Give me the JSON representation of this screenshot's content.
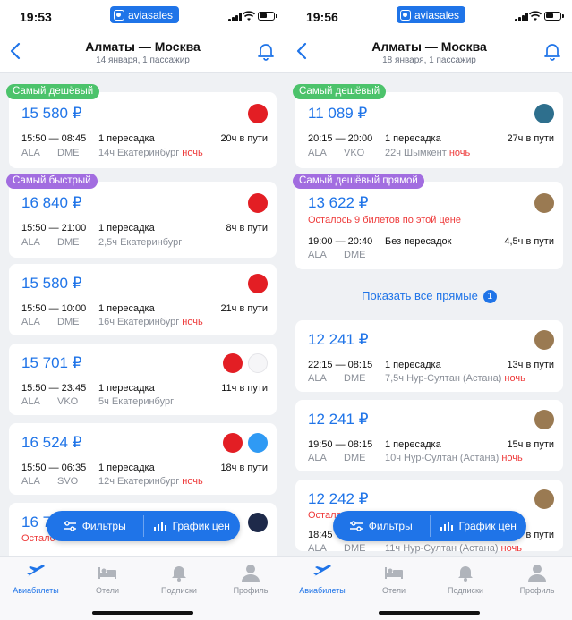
{
  "app_badge": "aviasales",
  "tabs": [
    {
      "label": "Авиабилеты",
      "icon": "plane-icon",
      "active": true
    },
    {
      "label": "Отели",
      "icon": "bed-icon",
      "active": false
    },
    {
      "label": "Подписки",
      "icon": "bell-icon",
      "active": false
    },
    {
      "label": "Профиль",
      "icon": "person-icon",
      "active": false
    }
  ],
  "floatbar": {
    "filters": "Фильтры",
    "chart": "График цен"
  },
  "colors": {
    "accent": "#1f74e8",
    "cheapest_tag": "#4cc36b",
    "fastest_tag": "#a26de0",
    "night": "#ee3a3a",
    "background": "#eff1f4"
  },
  "left": {
    "time": "19:53",
    "title": "Алматы — Москва",
    "subtitle": "14 января, 1 пассажир",
    "tickets": [
      {
        "tag": "Самый дешёвый",
        "price": "15 580 ₽",
        "dep": "15:50",
        "arr": "08:45",
        "stops": "1 пересадка",
        "duration": "20ч в пути",
        "from": "ALA",
        "to": "DME",
        "via": "14ч Екатеринбург",
        "night": "ночь"
      },
      {
        "tag": "Самый быстрый",
        "price": "16 840 ₽",
        "dep": "15:50",
        "arr": "21:00",
        "stops": "1 пересадка",
        "duration": "8ч в пути",
        "from": "ALA",
        "to": "DME",
        "via": "2,5ч Екатеринбург",
        "night": ""
      },
      {
        "tag": "",
        "price": "15 580 ₽",
        "dep": "15:50",
        "arr": "10:00",
        "stops": "1 пересадка",
        "duration": "21ч в пути",
        "from": "ALA",
        "to": "DME",
        "via": "16ч Екатеринбург",
        "night": "ночь"
      },
      {
        "tag": "",
        "price": "15 701 ₽",
        "dep": "15:50",
        "arr": "23:45",
        "stops": "1 пересадка",
        "duration": "11ч в пути",
        "from": "ALA",
        "to": "VKO",
        "via": "5ч Екатеринбург",
        "night": ""
      },
      {
        "tag": "",
        "price": "16 524 ₽",
        "dep": "15:50",
        "arr": "06:35",
        "stops": "1 пересадка",
        "duration": "18ч в пути",
        "from": "ALA",
        "to": "SVO",
        "via": "12ч Екатеринбург",
        "night": "ночь"
      },
      {
        "tag": "",
        "price": "16 7",
        "warn": "Остало"
      }
    ]
  },
  "right": {
    "time": "19:56",
    "title": "Алматы — Москва",
    "subtitle": "18 января, 1 пассажир",
    "show_all": {
      "label": "Показать все прямые",
      "count": "1"
    },
    "tickets": [
      {
        "tag": "Самый дешёвый",
        "price": "11 089 ₽",
        "dep": "20:15",
        "arr": "20:00",
        "stops": "1 пересадка",
        "duration": "27ч в пути",
        "from": "ALA",
        "to": "VKO",
        "via": "22ч Шымкент",
        "night": "ночь"
      },
      {
        "tag": "Самый дешёвый прямой",
        "price": "13 622 ₽",
        "warn": "Осталось 9 билетов по этой цене",
        "dep": "19:00",
        "arr": "20:40",
        "stops": "Без пересадок",
        "duration": "4,5ч в пути",
        "from": "ALA",
        "to": "DME",
        "via": "",
        "night": ""
      },
      {
        "tag": "",
        "price": "12 241 ₽",
        "dep": "22:15",
        "arr": "08:15",
        "stops": "1 пересадка",
        "duration": "13ч в пути",
        "from": "ALA",
        "to": "DME",
        "via": "7,5ч Нур-Султан (Астана)",
        "night": "ночь"
      },
      {
        "tag": "",
        "price": "12 241 ₽",
        "dep": "19:50",
        "arr": "08:15",
        "stops": "1 пересадка",
        "duration": "15ч в пути",
        "from": "ALA",
        "to": "DME",
        "via": "10ч Нур-Султан (Астана)",
        "night": "ночь"
      },
      {
        "tag": "",
        "price": "12 242 ₽",
        "warn": "Остало",
        "dep": "18:45",
        "arr": "",
        "stops": "",
        "duration": "в пути",
        "from": "ALA",
        "to": "DME",
        "via": "11ч Нур-Султан (Астана)",
        "night": "ночь"
      }
    ]
  }
}
